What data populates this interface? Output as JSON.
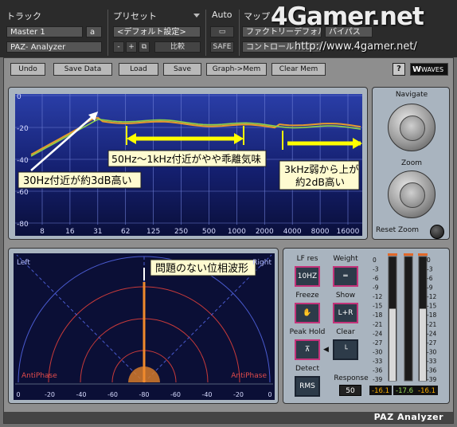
{
  "header": {
    "track_label": "トラック",
    "preset_label": "プリセット",
    "auto_label": "Auto",
    "map_label": "マップ",
    "track_value": "Master 1",
    "track_letter": "a",
    "plugin_value": "PAZ- Analyzer",
    "preset_value": "<デフォルト設定>",
    "minus_label": "-",
    "plus_label": "+",
    "compare_label": "比較",
    "safe_label": "SAFE",
    "factory_default_label": "ファクトリーデフォルト",
    "bypass_label": "バイパス",
    "control_label": "コントロール",
    "watermark": "4Gamer.net",
    "watermark_url": "http://www.4gamer.net/"
  },
  "toolbar": {
    "undo": "Undo",
    "save_data": "Save Data",
    "load": "Load",
    "save": "Save",
    "graph_mem": "Graph->Mem",
    "clear_mem": "Clear Mem",
    "help": "?",
    "logo": "WAVES"
  },
  "navigate": {
    "navigate_label": "Navigate",
    "zoom_label": "Zoom",
    "reset_zoom_label": "Reset Zoom"
  },
  "frequency": {
    "db_ticks": [
      "0",
      "-20",
      "-40",
      "-60",
      "-80"
    ],
    "freq_ticks": [
      "8",
      "16",
      "31",
      "62",
      "125",
      "250",
      "500",
      "1000",
      "2000",
      "4000",
      "8000",
      "16000"
    ],
    "annotation_1": "30Hz付近が約3dB高い",
    "annotation_2": "50Hz〜1kHz付近がやや乖離気味",
    "annotation_3_line1": "3kHz弱から上が",
    "annotation_3_line2": "約2dB高い"
  },
  "phase": {
    "left_label": "Left",
    "right_label": "Right",
    "antiphase_left": "AntiPhase",
    "antiphase_right": "AntiPhase",
    "annotation": "問題のない位相波形",
    "scale_ticks": [
      "0",
      "-20",
      "-40",
      "-60",
      "-80",
      "-60",
      "-40",
      "-20",
      "0"
    ]
  },
  "controls": {
    "lf_res_label": "LF res",
    "lf_res_value": "10HZ",
    "weight_label": "Weight",
    "freeze_label": "Freeze",
    "show_label": "Show",
    "show_value": "L+R",
    "peak_hold_label": "Peak Hold",
    "clear_label": "Clear",
    "detect_label": "Detect",
    "detect_value": "RMS",
    "response_label": "Response",
    "response_value": "50"
  },
  "meters": {
    "scale": [
      "0",
      "-3",
      "-6",
      "-9",
      "-12",
      "-15",
      "-18",
      "-21",
      "-24",
      "-27",
      "-30",
      "-33",
      "-36",
      "-39"
    ],
    "readouts": [
      "-16.1",
      "-17.6",
      "-16.1"
    ],
    "levels": [
      0.58,
      0.0,
      0.58
    ]
  },
  "footer": {
    "title": "PAZ Analyzer"
  }
}
